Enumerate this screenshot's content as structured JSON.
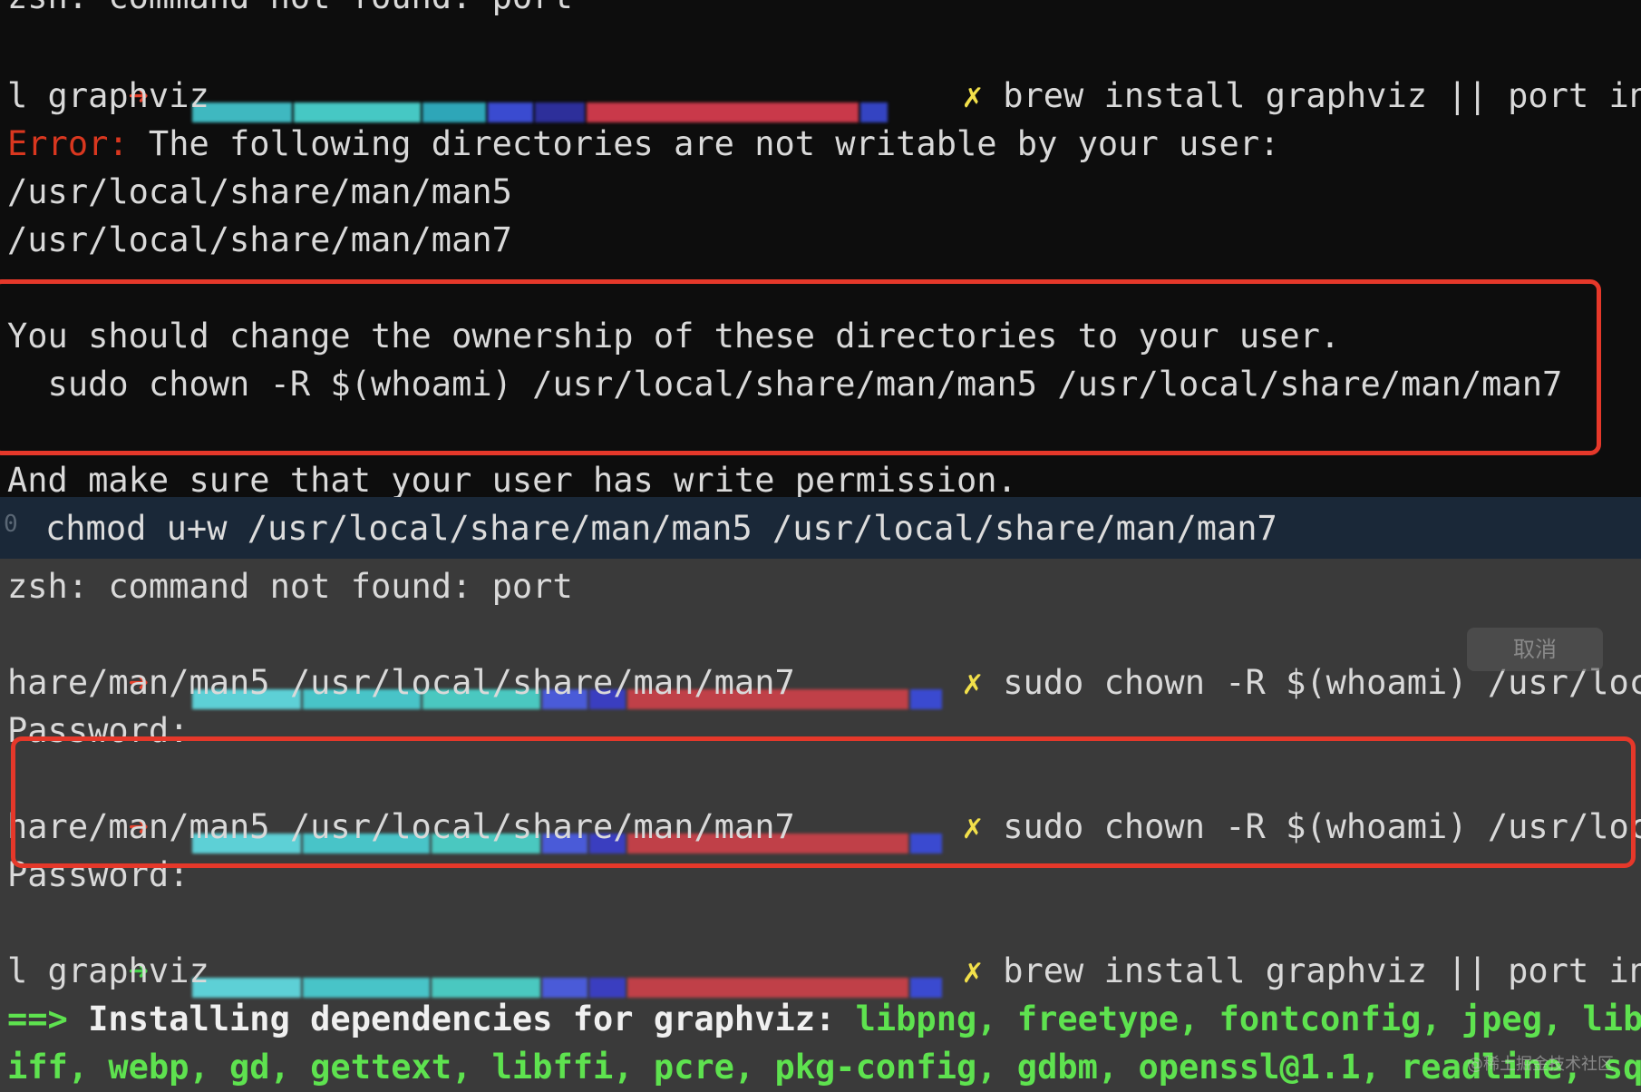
{
  "colors": {
    "prompt_red": "#e8412c",
    "prompt_green": "#45d34b",
    "dirty_marker": "#f2e04a",
    "error_red": "#d9371f",
    "dependency_green": "#5ee24f",
    "highlight_box": "#e5382a"
  },
  "icons": {
    "prompt_arrow": "arrow-right",
    "dirty_marker": "x-mark"
  },
  "top": {
    "line0": "zsh: command not found: port",
    "prompt1": {
      "arrow": "➜",
      "marker": "✗",
      "command": " brew install graphviz || port instal"
    },
    "line2": "l graphviz",
    "error_label": "Error:",
    "error_message": " The following directories are not writable by your user:",
    "dir1": "/usr/local/share/man/man5",
    "dir2": "/usr/local/share/man/man7",
    "advice": "You should change the ownership of these directories to your user.",
    "chown_cmd": "  sudo chown -R $(whoami) /usr/local/share/man/man5 /usr/local/share/man/man7",
    "and_make_sure": "And make sure that your user has write permission."
  },
  "mid": {
    "gutter": "0",
    "chmod_cmd": "chmod u+w /usr/local/share/man/man5 /usr/local/share/man/man7"
  },
  "bottom": {
    "port_not_found": "zsh: command not found: port",
    "prompt2": {
      "arrow": "➜",
      "marker": "✗",
      "command": " sudo chown -R $(whoami) /usr/local/s"
    },
    "prompt2_cont": "hare/man/man5 /usr/local/share/man/man7",
    "password1": "Password:",
    "cancel_hint": "取消",
    "prompt3": {
      "arrow": "➜",
      "marker": "✗",
      "command": " sudo chown -R $(whoami) /usr/local/s"
    },
    "prompt3_cont": "hare/man/man5 /usr/local/share/man/man7",
    "password2": "Password:",
    "prompt4": {
      "arrow": "➜",
      "marker": "✗",
      "command": " brew install graphviz || port instal"
    },
    "prompt4_cont": "l graphviz",
    "installing_arrow": "==>",
    "installing_label": " Installing dependencies for graphviz: ",
    "deps_line1": "libpng, freetype, fontconfig, jpeg, libt",
    "deps_line2": "iff, webp, gd, gettext, libffi, pcre, pkg-config, gdbm, openssl@1.1, readline, sql"
  },
  "watermark": "@稀土掘金技术社区"
}
